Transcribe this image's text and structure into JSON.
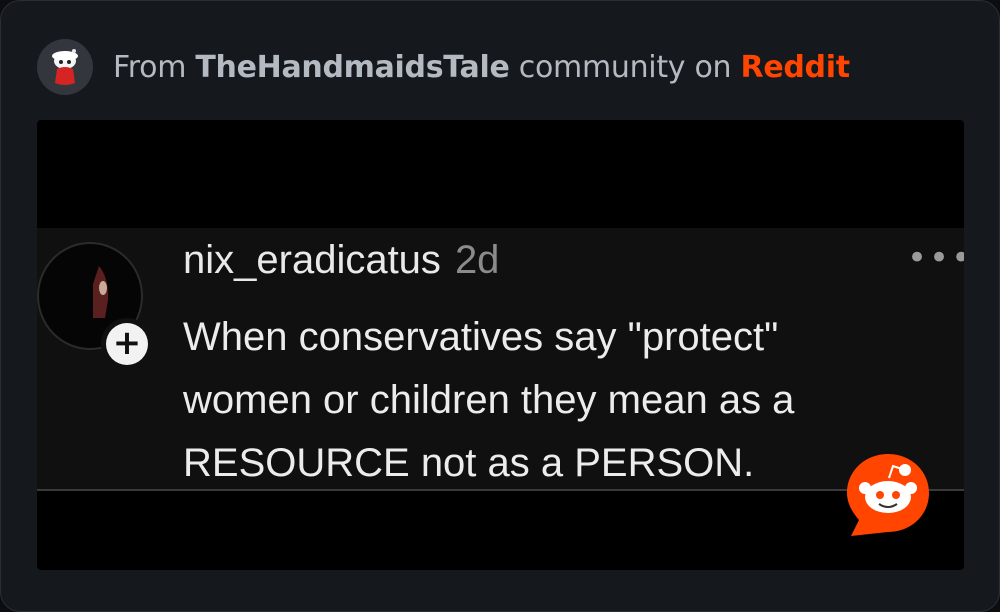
{
  "header": {
    "prefix": "From",
    "community": "TheHandmaidsTale",
    "middle": "community on",
    "brand": "Reddit",
    "brand_color": "#ff4500",
    "avatar_icon": "handmaid-snoo-avatar-icon"
  },
  "post": {
    "username": "nix_eradicatus",
    "age": "2d",
    "text": "When conservatives say \"protect\"\nwomen or children they mean as a\nRESOURCE not as a PERSON.",
    "follow_symbol": "+",
    "more_symbol": "•••",
    "badge_icon": "reddit-snoo-icon"
  }
}
